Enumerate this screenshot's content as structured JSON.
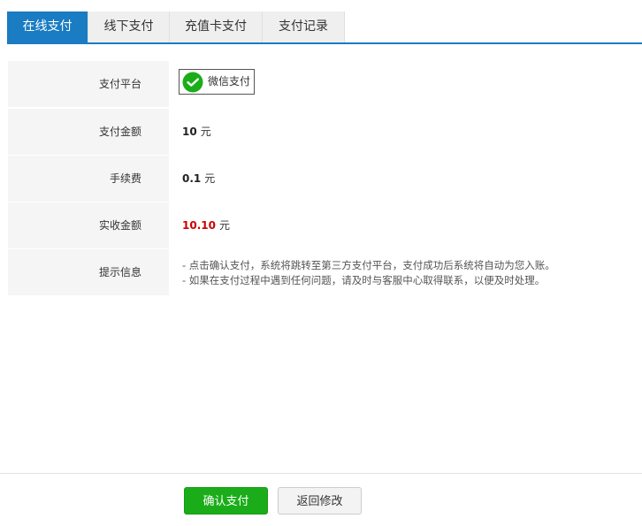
{
  "tabs": [
    "在线支付",
    "线下支付",
    "充值卡支付",
    "支付记录"
  ],
  "rows": {
    "platform": {
      "label": "支付平台",
      "option": "微信支付",
      "logo_color": "#1aad19"
    },
    "amount": {
      "label": "支付金额",
      "value": "10",
      "unit": "元"
    },
    "fee": {
      "label": "手续费",
      "value": "0.1",
      "unit": "元"
    },
    "received": {
      "label": "实收金额",
      "value": "10.10",
      "unit": "元",
      "value_color": "#cc0000"
    },
    "tips": {
      "label": "提示信息",
      "lines": [
        "- 点击确认支付，系统将跳转至第三方支付平台，支付成功后系统将自动为您入账。",
        "- 如果在支付过程中遇到任何问题，请及时与客服中心取得联系，以便及时处理。"
      ]
    }
  },
  "buttons": {
    "confirm": "确认支付",
    "back": "返回修改"
  },
  "colors": {
    "tab_active": "#1a7cc2",
    "confirm": "#1aad19"
  }
}
